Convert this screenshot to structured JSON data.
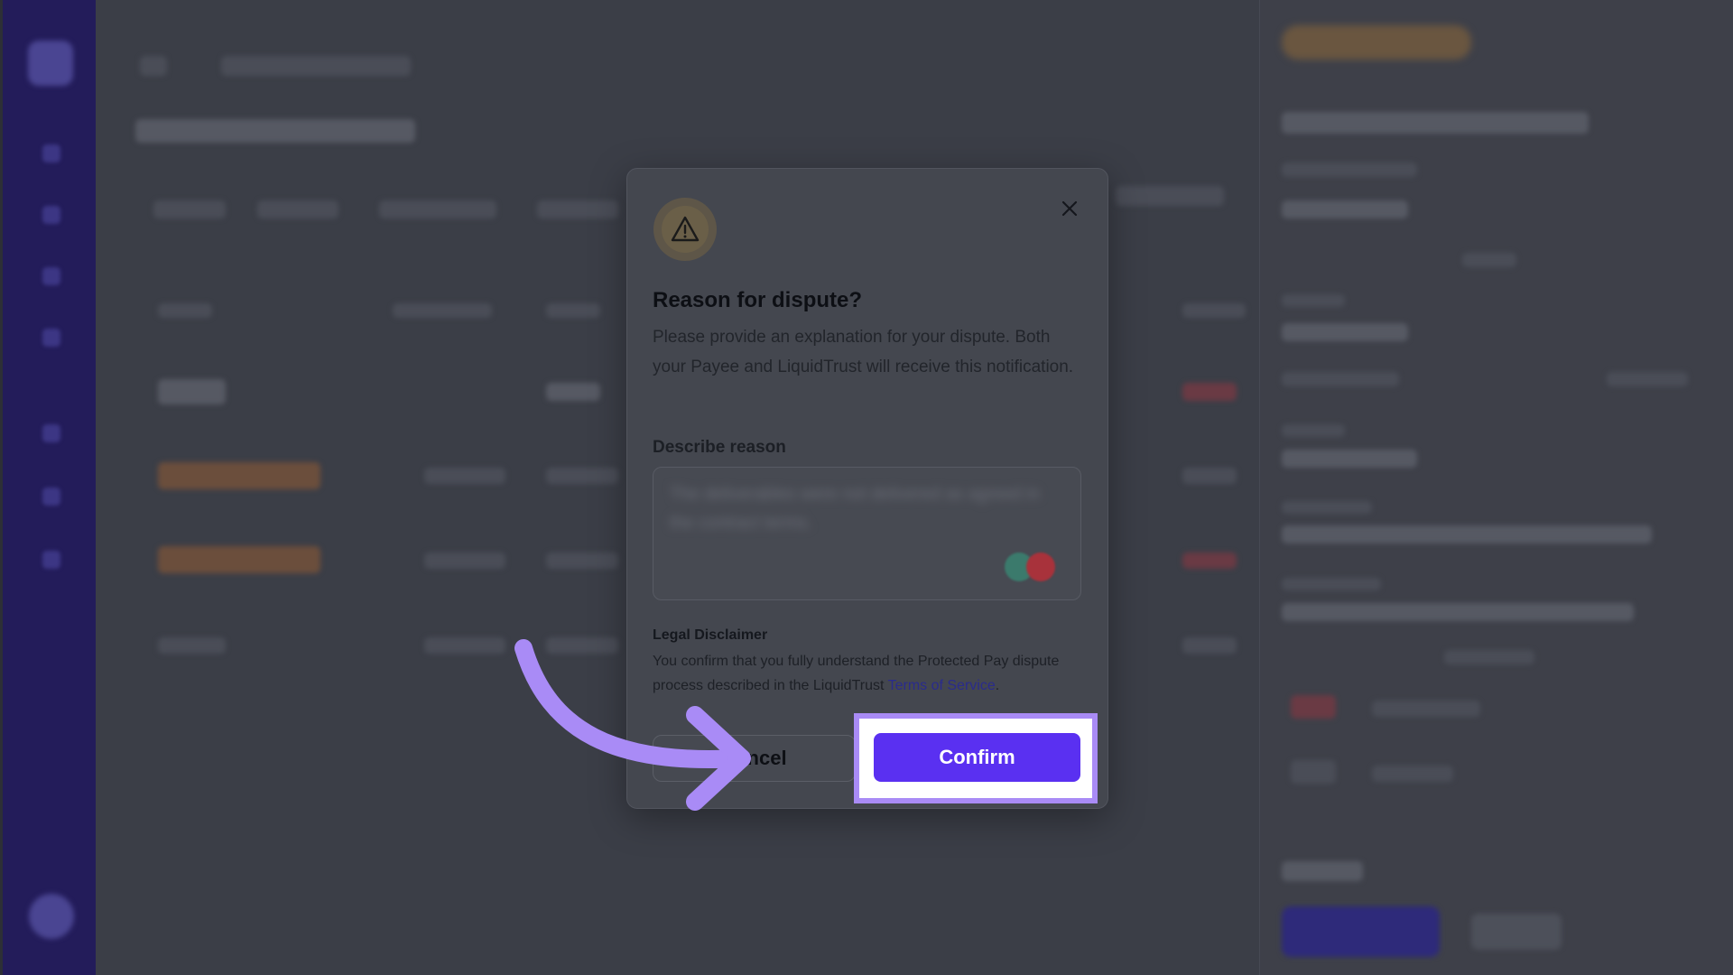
{
  "modal": {
    "title": "Reason for dispute?",
    "description": "Please provide an explanation for your dispute. Both your Payee and LiquidTrust will receive this notification.",
    "field_label": "Describe reason",
    "reason_text": "The deliverables were not delivered as agreed in the contract terms.",
    "legal_title": "Legal Disclaimer",
    "legal_text": "You confirm that you fully understand the Protected Pay dispute process described in the LiquidTrust",
    "tos_link": "Terms of Service",
    "tos_suffix": ".",
    "cancel_label": "Cancel",
    "confirm_label": "Confirm"
  },
  "icons": {
    "warning": "warning-triangle-icon",
    "close": "close-icon",
    "arrow": "curved-arrow-annotation"
  },
  "colors": {
    "sidebar": "#231c5a",
    "primary": "#5a30f1",
    "highlight_border": "#a98bf6",
    "arrow": "#a98bf6",
    "link": "#2a2b8c"
  }
}
